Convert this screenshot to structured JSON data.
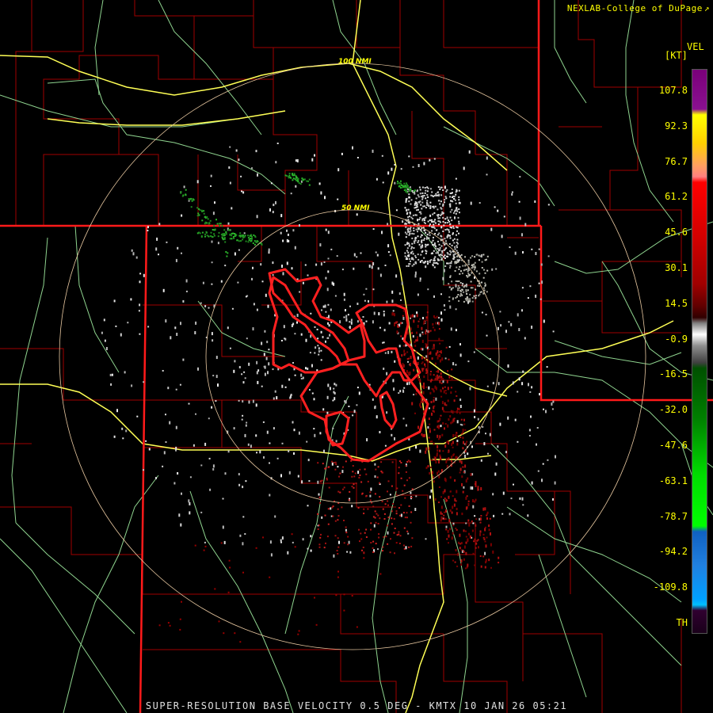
{
  "credit": "NEXLAB-College of DuPage",
  "credit_icon": "external-link-icon",
  "legend": {
    "product": "VEL",
    "units": "[KT]",
    "labels": [
      "107.8",
      "92.3",
      "76.7",
      "61.2",
      "45.6",
      "30.1",
      "14.5",
      "-0.9",
      "-16.5",
      "-32.0",
      "-47.6",
      "-63.1",
      "-78.7",
      "-94.2",
      "-109.8",
      "TH"
    ]
  },
  "range_rings": {
    "outer_label": "100 NMI",
    "inner_label": "50 NMI"
  },
  "footer": "SUPER-RESOLUTION BASE VELOCITY 0.5 DEG - KMTX 10 JAN 26 05:21",
  "colors": {
    "background": "#000000",
    "text": "#ffff00",
    "state_border": "#ff1a1a",
    "county_border": "#b00000",
    "highway": "#ffff66",
    "road": "#9adf9a",
    "range_ring": "#e8c8a0",
    "warning_polygon": "#ff2020",
    "inbound": "#2bb52b",
    "outbound": "#b01010",
    "near_zero": "#c8c8c8"
  }
}
